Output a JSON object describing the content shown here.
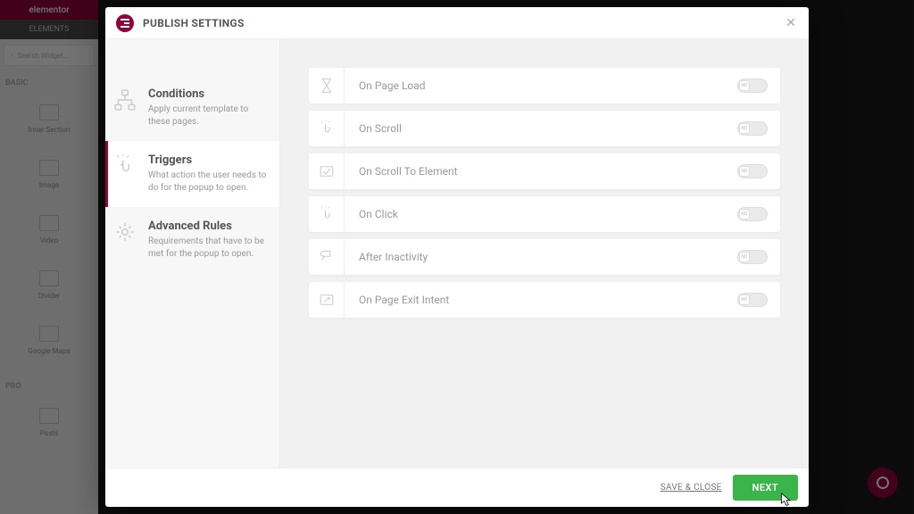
{
  "bg": {
    "brand": "elementor",
    "tab_elements": "ELEMENTS",
    "search_placeholder": "Search Widget…",
    "cat_basic": "BASIC",
    "cat_pro": "PRO",
    "widgets_basic": [
      "Inner Section",
      "Image",
      "Video",
      "Divider",
      "Google Maps"
    ],
    "widget_pro": "Posts"
  },
  "modal": {
    "title": "PUBLISH SETTINGS",
    "side": [
      {
        "title": "Conditions",
        "desc": "Apply current template to these pages."
      },
      {
        "title": "Triggers",
        "desc": "What action the user needs to do for the popup to open."
      },
      {
        "title": "Advanced Rules",
        "desc": "Requirements that have to be met for the popup to open."
      }
    ],
    "active_idx": 1,
    "triggers": [
      {
        "label": "On Page Load",
        "on": false
      },
      {
        "label": "On Scroll",
        "on": false
      },
      {
        "label": "On Scroll To Element",
        "on": false
      },
      {
        "label": "On Click",
        "on": false
      },
      {
        "label": "After Inactivity",
        "on": false
      },
      {
        "label": "On Page Exit Intent",
        "on": false
      }
    ],
    "save_and_close": "SAVE & CLOSE",
    "next": "NEXT"
  }
}
